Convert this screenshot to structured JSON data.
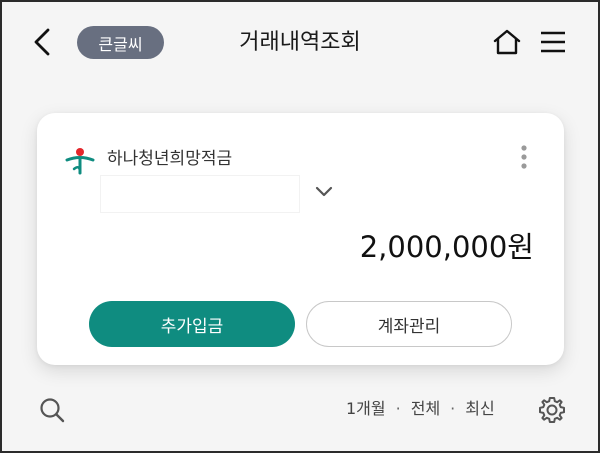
{
  "header": {
    "back_icon": "chevron-left-icon",
    "large_text_label": "큰글씨",
    "title": "거래내역조회",
    "home_icon": "home-icon",
    "menu_icon": "hamburger-menu-icon"
  },
  "account_card": {
    "logo_icon": "hana-bank-logo-icon",
    "account_name": "하나청년희망적금",
    "account_number": "",
    "expand_icon": "chevron-down-icon",
    "more_icon": "kebab-menu-icon",
    "balance": "2,000,000원",
    "deposit_button_label": "추가입금",
    "manage_button_label": "계좌관리"
  },
  "filter_bar": {
    "search_icon": "search-icon",
    "period": "1개월",
    "type": "전체",
    "order": "최신",
    "separator": "·",
    "settings_icon": "gear-icon"
  },
  "colors": {
    "accent": "#0f8c80",
    "pill_bg": "#686f80",
    "background": "#f5f5f5",
    "logo_red": "#e3262b",
    "logo_teal": "#0f8c80"
  }
}
